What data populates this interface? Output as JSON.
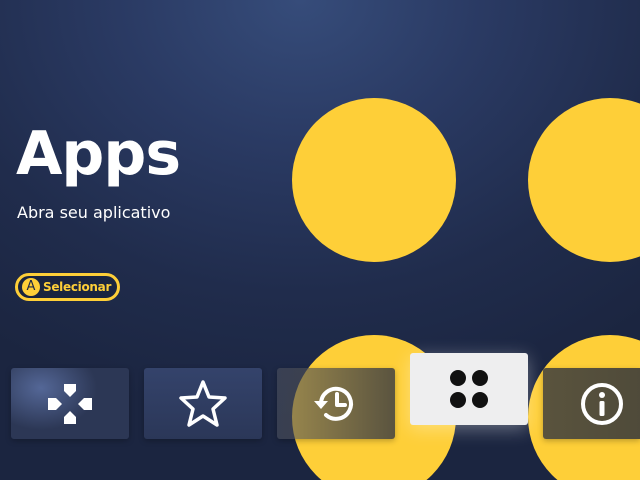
{
  "header": {
    "title": "Apps",
    "subtitle": "Abra seu aplicativo"
  },
  "hint": {
    "button": "A",
    "label": "Selecionar"
  },
  "menu": {
    "items": [
      {
        "icon": "gamepad-icon",
        "selected": false
      },
      {
        "icon": "star-icon",
        "selected": false
      },
      {
        "icon": "history-icon",
        "selected": false
      },
      {
        "icon": "apps-grid-icon",
        "selected": true
      },
      {
        "icon": "info-icon",
        "selected": false
      }
    ]
  },
  "colors": {
    "accent": "#fecf38",
    "background": "#202c4c",
    "selected_tile": "#eeeeef"
  }
}
